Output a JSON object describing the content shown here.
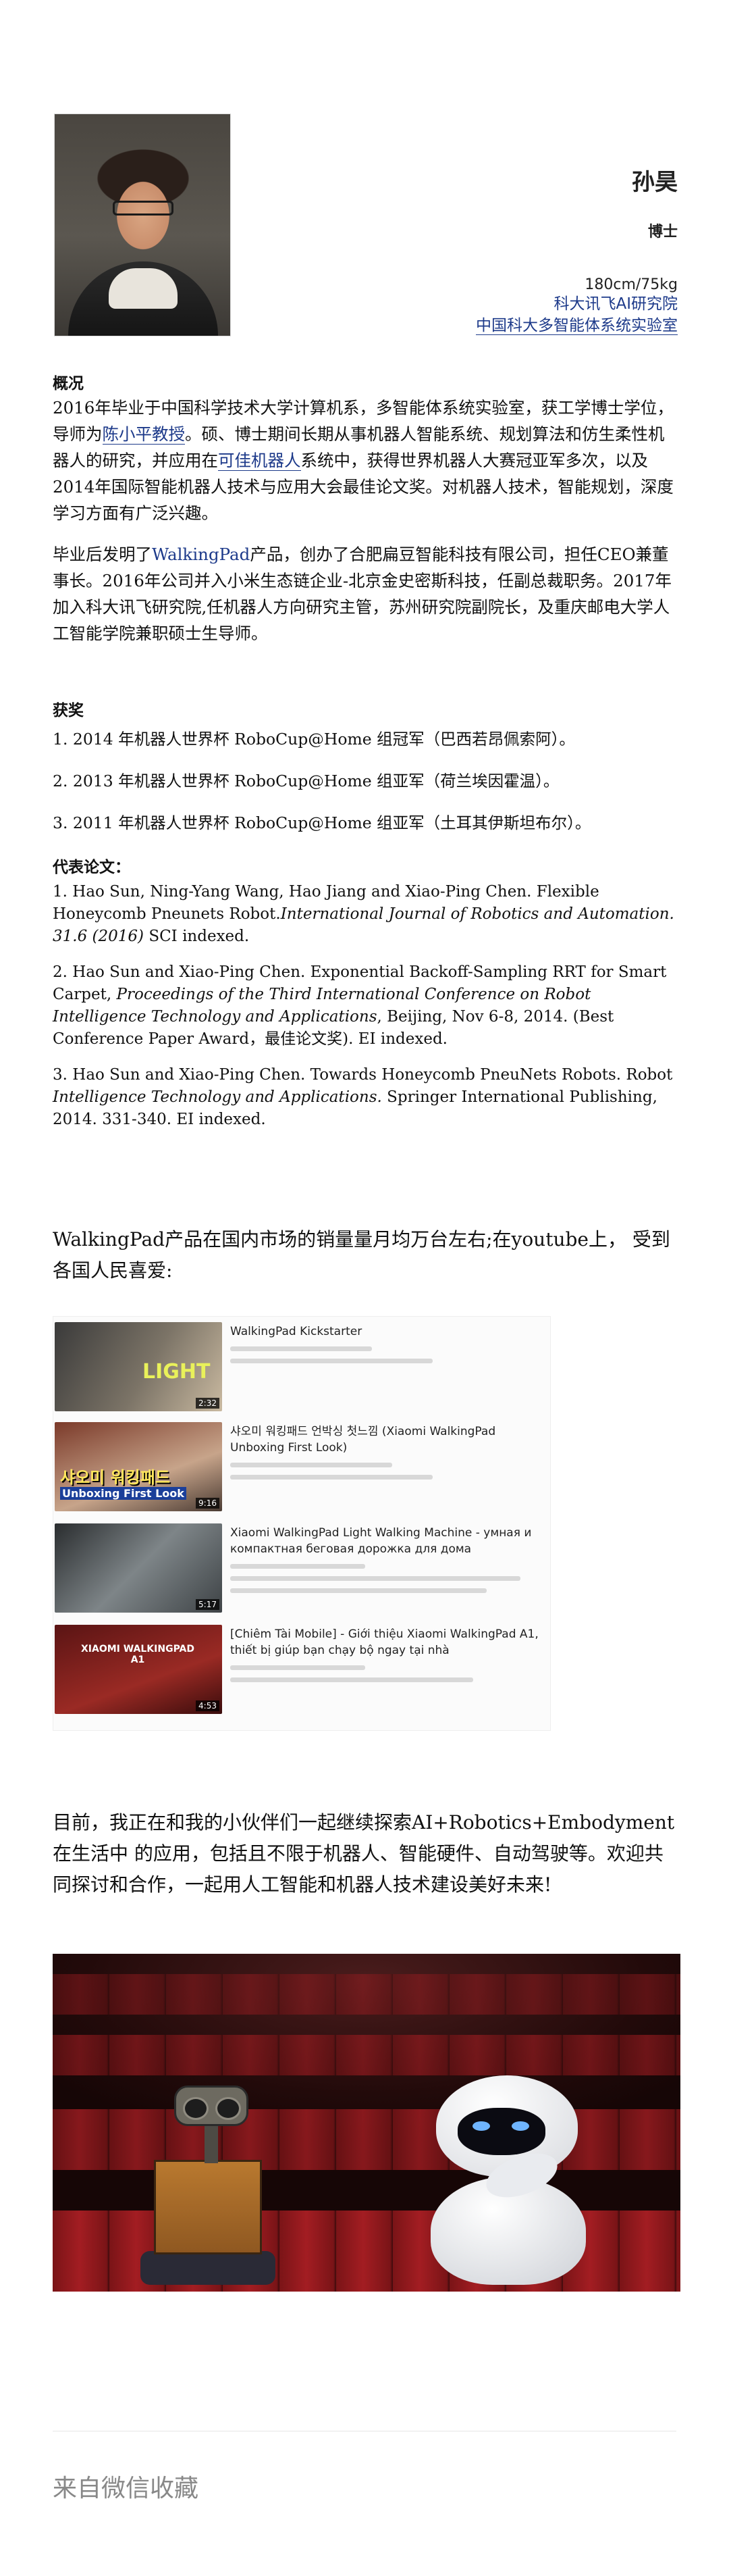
{
  "profile": {
    "name": "孙昊",
    "degree": "博士",
    "height_weight": "180cm/75kg",
    "affiliation1": "科大讯飞AI研究院",
    "affiliation2": "中国科大多智能体系统实验室"
  },
  "overview": {
    "heading": "概况",
    "p1_a": "2016年毕业于中国科学技术大学计算机系，多智能体系统实验室，获工学博士学位，导师为",
    "p1_link1": "陈小平教授",
    "p1_b": "。硕、博士期间长期从事机器人智能系统、规划算法和仿生柔性机器人的研究，并应用在",
    "p1_link2": "可佳机器人",
    "p1_c": "系统中，获得世界机器人大赛冠亚军多次，以及2014年国际智能机器人技术与应用大会最佳论文奖。对机器人技术，智能规划，深度学习方面有广泛兴趣。",
    "p2_a": "毕业后发明了",
    "p2_link": "WalkingPad",
    "p2_b": "产品，创办了合肥扁豆智能科技有限公司，担任CEO兼董事长。2016年公司并入小米生态链企业-北京金史密斯科技，任副总裁职务。2017年加入科大讯飞研究院,任机器人方向研究主管，苏州研究院副院长，及重庆邮电大学人工智能学院兼职硕士生导师。"
  },
  "awards": {
    "heading": "获奖",
    "items": [
      "1. 2014 年机器人世界杯 RoboCup@Home 组冠军（巴西若昂佩索阿）。",
      "2. 2013 年机器人世界杯 RoboCup@Home 组亚军（荷兰埃因霍温）。",
      "3. 2011 年机器人世界杯 RoboCup@Home 组亚军（土耳其伊斯坦布尔）。"
    ]
  },
  "papers": {
    "heading": "代表论文：",
    "p1_a": "1. Hao Sun, Ning-Yang Wang, Hao Jiang and Xiao-Ping Chen. Flexible Honeycomb Pneunets Robot.",
    "p1_em": "International Journal of Robotics and Automation. 31.6 (2016)",
    "p1_b": " SCI indexed.",
    "p2_a": "2. Hao Sun and Xiao-Ping Chen. Exponential Backoff-Sampling RRT for Smart Carpet, ",
    "p2_em": "Proceedings of the Third International Conference on Robot Intelligence Technology and Applications",
    "p2_b": ", Beijing, Nov 6-8, 2014. (Best Conference Paper Award，最佳论文奖). EI indexed.",
    "p3_a": "3. Hao Sun and Xiao-Ping Chen. Towards Honeycomb PneuNets Robots. Robot ",
    "p3_em": "Intelligence Technology and Applications.",
    "p3_b": " Springer International Publishing, 2014. 331-340. EI indexed."
  },
  "sales_text": "WalkingPad产品在国内市场的销量量月均万台左右;在youtube上， 受到各国人民喜爱:",
  "videos": [
    {
      "title": "WalkingPad Kickstarter",
      "overlay": "LIGHT",
      "duration": "2:32"
    },
    {
      "title": "샤오미 워킹패드 언박싱 첫느낌 (Xiaomi WalkingPad Unboxing First Look)",
      "overlay": "샤오미 워킹패드",
      "overlay2": "Unboxing First Look",
      "duration": "9:16"
    },
    {
      "title": "Xiaomi WalkingPad Light Walking Machine - умная и компактная беговая дорожка для дома",
      "overlay": "",
      "duration": "5:17"
    },
    {
      "title": "[Chiêm Tài Mobile] - Giới thiệu Xiaomi WalkingPad A1, thiết bị giúp bạn chạy bộ ngay tại nhà",
      "overlay": "XIAOMI WALKINGPAD A1",
      "duration": "4:53"
    }
  ],
  "closing_text": "目前，我正在和我的小伙伴们一起继续探索AI+Robotics+Embodyment在生活中 的应用，包括且不限于机器人、智能硬件、自动驾驶等。欢迎共同探讨和合作，一起用人工智能和机器人技术建设美好未来!",
  "footer": "来自微信收藏"
}
